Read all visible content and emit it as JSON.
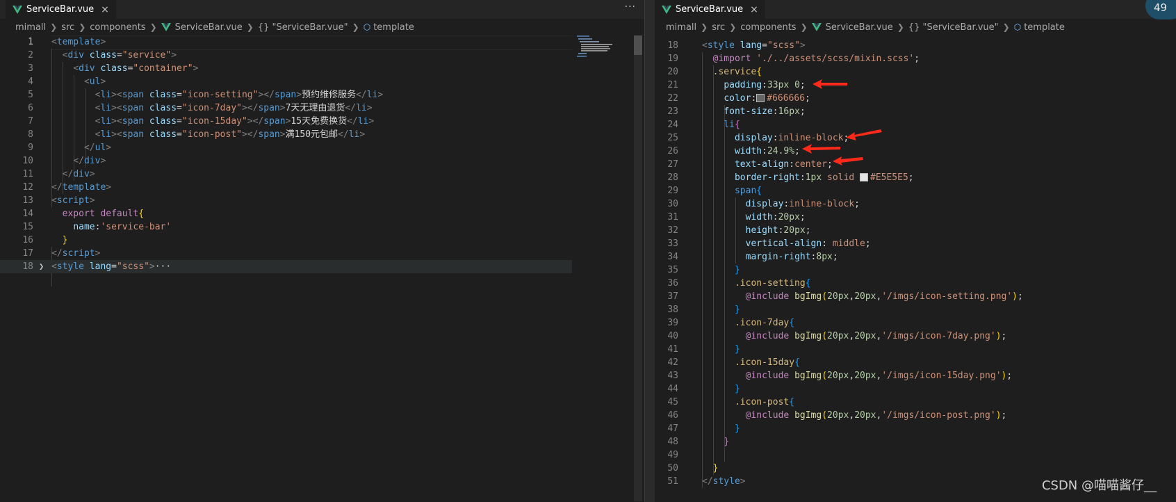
{
  "left": {
    "tab": {
      "label": "ServiceBar.vue",
      "close": "×"
    },
    "more": "···",
    "breadcrumb": {
      "p1": "mimall",
      "p2": "src",
      "p3": "components",
      "p4": "ServiceBar.vue",
      "p5": "{} \"ServiceBar.vue\"",
      "p6": "template"
    },
    "lines": [
      {
        "n": "1"
      },
      {
        "n": "2"
      },
      {
        "n": "3"
      },
      {
        "n": "4"
      },
      {
        "n": "5",
        "text": "预约维修服务"
      },
      {
        "n": "6",
        "text": "7天无理由退货"
      },
      {
        "n": "7",
        "text": "15天免费换货"
      },
      {
        "n": "8",
        "text": "满150元包邮"
      },
      {
        "n": "9"
      },
      {
        "n": "10"
      },
      {
        "n": "11"
      },
      {
        "n": "12"
      },
      {
        "n": "13"
      },
      {
        "n": "14"
      },
      {
        "n": "15"
      },
      {
        "n": "16"
      },
      {
        "n": "17"
      },
      {
        "n": "18"
      }
    ]
  },
  "right": {
    "tab": {
      "label": "ServiceBar.vue",
      "close": "×"
    },
    "breadcrumb": {
      "p1": "mimall",
      "p2": "src",
      "p3": "components",
      "p4": "ServiceBar.vue",
      "p5": "{} \"ServiceBar.vue\"",
      "p6": "template"
    },
    "badge": "49",
    "numbers": [
      "18",
      "19",
      "20",
      "21",
      "22",
      "23",
      "24",
      "25",
      "26",
      "27",
      "28",
      "29",
      "30",
      "31",
      "32",
      "33",
      "34",
      "35",
      "36",
      "37",
      "38",
      "39",
      "40",
      "41",
      "42",
      "43",
      "44",
      "45",
      "46",
      "47",
      "48",
      "49",
      "50",
      "51"
    ],
    "colors": {
      "gray": "#666666",
      "border": "#E5E5E5",
      "arrow": "#ff2a1a"
    }
  },
  "watermark": "CSDN @喵喵酱仔__"
}
